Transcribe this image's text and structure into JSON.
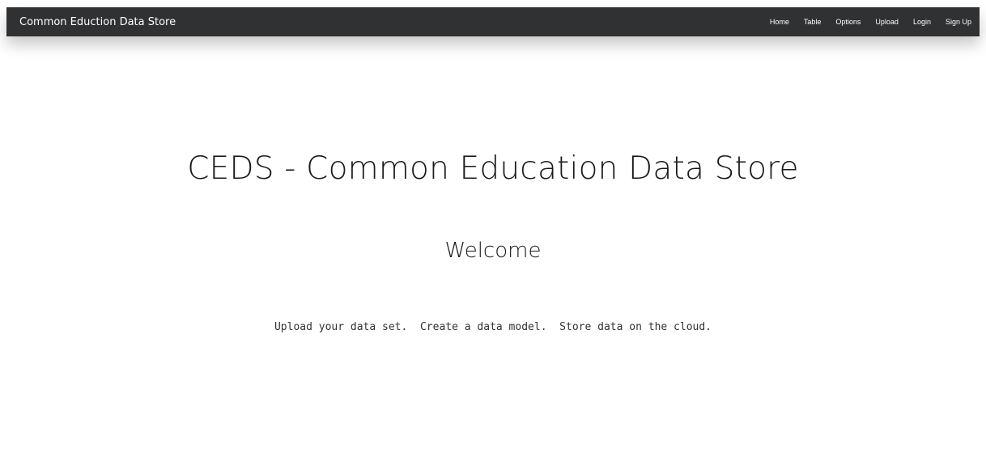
{
  "navbar": {
    "brand": "Common Eduction Data Store",
    "links": [
      {
        "label": "Home"
      },
      {
        "label": "Table"
      },
      {
        "label": "Options"
      },
      {
        "label": "Upload"
      },
      {
        "label": "Login"
      },
      {
        "label": "Sign Up"
      }
    ],
    "background_color": "#2f3133"
  },
  "main": {
    "title": "CEDS - Common Education Data Store",
    "subtitle": "Welcome",
    "tagline": "Upload your data set.  Create a data model.  Store data on the cloud."
  }
}
